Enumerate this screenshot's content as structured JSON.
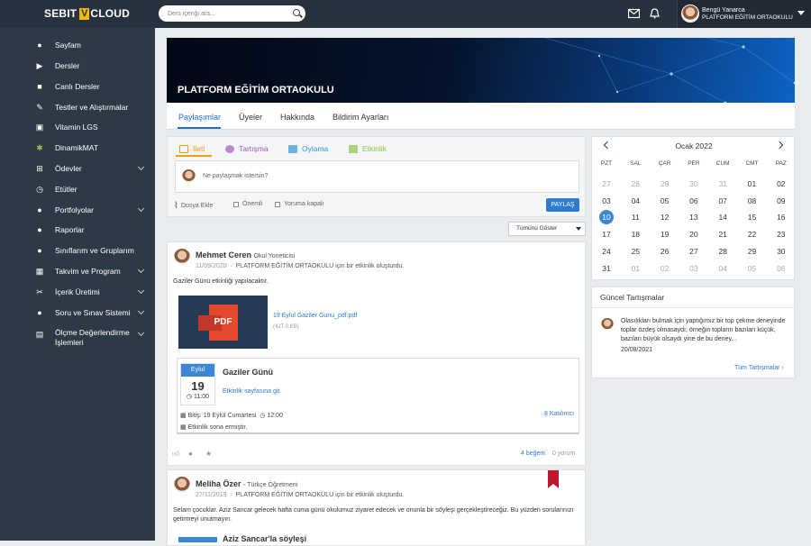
{
  "header": {
    "logo_left": "SEBIT",
    "logo_v": "V",
    "logo_right": "CLOUD",
    "search_placeholder": "Ders içeriği ara...",
    "user_name": "Bengü Yanarca",
    "user_school": "PLATFORM EĞİTİM ORTAOKULU"
  },
  "sidebar": {
    "items": [
      {
        "label": "Sayfam",
        "icon": "user-icon"
      },
      {
        "label": "Dersler",
        "icon": "play-icon"
      },
      {
        "label": "Canlı Dersler",
        "icon": "video-icon"
      },
      {
        "label": "Testler ve Alıştırmalar",
        "icon": "pencil-icon"
      },
      {
        "label": "Vitamin LGS",
        "icon": "vitamin-icon"
      },
      {
        "label": "DinamikMAT",
        "icon": "gear-icon"
      },
      {
        "label": "Ödevler",
        "icon": "homework-icon"
      },
      {
        "label": "Etütler",
        "icon": "clock-icon"
      },
      {
        "label": "Portfolyolar",
        "icon": "portfolio-icon"
      },
      {
        "label": "Raporlar",
        "icon": "report-icon"
      },
      {
        "label": "Sınıflarım ve Gruplarım",
        "icon": "group-icon"
      },
      {
        "label": "Takvim ve Program",
        "icon": "calendar-icon"
      },
      {
        "label": "İçerik Üretimi",
        "icon": "tools-icon"
      },
      {
        "label": "Soru ve Sınav Sistemi",
        "icon": "exam-icon"
      },
      {
        "label": "Ölçme Değerlendirme İşlemleri",
        "icon": "assessment-icon"
      }
    ]
  },
  "banner": {
    "title": "PLATFORM EĞİTİM ORTAOKULU"
  },
  "tabs": [
    "Paylaşımlar",
    "Üyeler",
    "Hakkında",
    "Bildirim Ayarları"
  ],
  "composer": {
    "tabs": [
      {
        "label": "İleti",
        "color": "#f39c12"
      },
      {
        "label": "Tartışma",
        "color": "#9b59b6"
      },
      {
        "label": "Oylama",
        "color": "#3498db"
      },
      {
        "label": "Etkinlik",
        "color": "#8bc34a"
      }
    ],
    "placeholder": "Ne paylaşmak istersin?",
    "attach": "Dosya Ekle",
    "important": "Önemli",
    "comments_closed": "Yoruma kapalı",
    "share": "PAYLAŞ"
  },
  "filter": {
    "value": "Tümünü Göster"
  },
  "posts": [
    {
      "author": "Mehmet Ceren",
      "role": "Okul Yoneticisi",
      "date": "11/09/2020",
      "sep": "·",
      "school": "PLATFORM EĞİTİM ORTAOKULU",
      "action": "için bir etkinlik oluşturdu.",
      "text": "Gaziler Günü etkinliği yapılacaktır.",
      "pdf_label": "PDF",
      "file_name": "19 Eylul Gaziler Gunu_pdf.pdf",
      "file_size": "(427.0 KB)",
      "event": {
        "month": "Eylul",
        "day": "19",
        "time": "11:00",
        "title": "Gaziler Günü",
        "link": "Etkinlik sayfasına git",
        "end": "Bitiş: 19 Eylül Cumartesi",
        "end_time": "12:00",
        "ended": "Etkinlik sona ermiştir.",
        "participants": "8 Katılımcı"
      },
      "likes": "4 beğeni",
      "comments": "0 yorum"
    },
    {
      "author": "Meliha Özer",
      "role": "- Türkçe Öğretmeni",
      "date": "27/11/2019",
      "sep": "·",
      "school": "PLATFORM EĞİTİM ORTAOKULU",
      "action": "için bir etkinlik oluşturdu.",
      "text": "Selam çocuklar. Aziz Sancar gelecek hafta cuma günü okulumuz ziyaret edecek ve onunla bir söyleşi gerçekleştireceğiz. Bu yüzden sorularınızı getirmeyi unutmayın.",
      "event_title": "Aziz Sancar'la söyleşi"
    }
  ],
  "calendar": {
    "month": "Ocak 2022",
    "weekdays": [
      "PZT",
      "SAL",
      "ÇAR",
      "PER",
      "CUM",
      "CMT",
      "PAZ"
    ],
    "weeks": [
      [
        "27",
        "28",
        "29",
        "30",
        "31",
        "01",
        "02"
      ],
      [
        "03",
        "04",
        "05",
        "06",
        "07",
        "08",
        "09"
      ],
      [
        "10",
        "11",
        "12",
        "13",
        "14",
        "15",
        "16"
      ],
      [
        "17",
        "18",
        "19",
        "20",
        "21",
        "22",
        "23"
      ],
      [
        "24",
        "25",
        "26",
        "27",
        "28",
        "29",
        "30"
      ],
      [
        "31",
        "01",
        "02",
        "03",
        "04",
        "05",
        "06"
      ]
    ],
    "muted": [
      [
        0,
        0
      ],
      [
        0,
        1
      ],
      [
        0,
        2
      ],
      [
        0,
        3
      ],
      [
        0,
        4
      ],
      [
        5,
        1
      ],
      [
        5,
        2
      ],
      [
        5,
        3
      ],
      [
        5,
        4
      ],
      [
        5,
        5
      ],
      [
        5,
        6
      ]
    ],
    "today": [
      2,
      0
    ]
  },
  "discussions": {
    "title": "Güncel Tartışmalar",
    "text": "Olasılıkları bulmak için yaptığımız bir top çekme deneyinde toplar özdeş olmasaydı; örneğin topların bazıları küçük, bazıları büyük olsaydı yine de bu deney...",
    "date": "20/08/2021",
    "all": "Tüm Tartışmalar ›"
  }
}
